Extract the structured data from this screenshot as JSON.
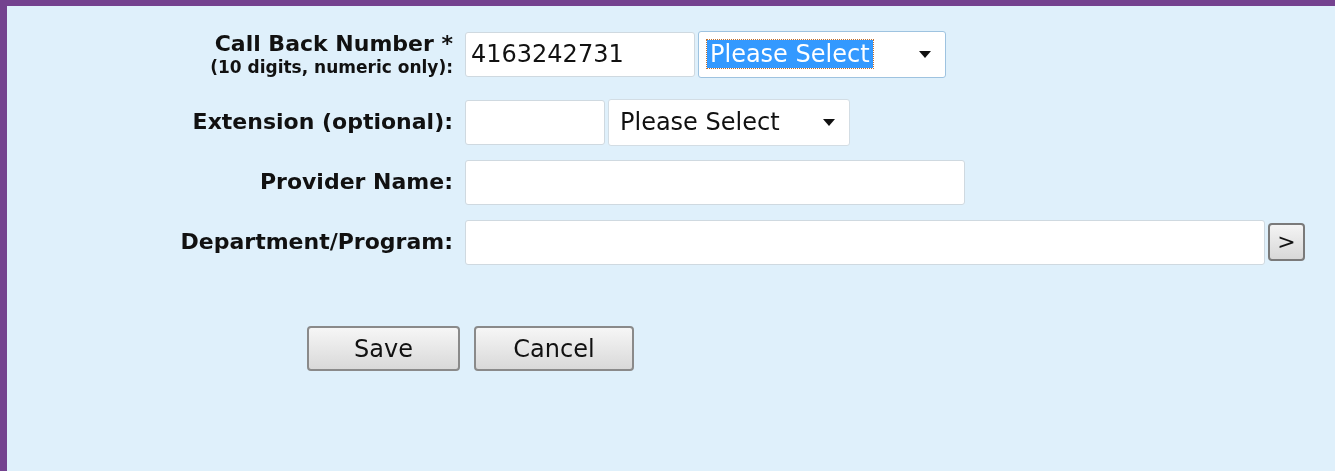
{
  "form": {
    "rows": [
      {
        "kind": "phone",
        "label": "Call Back Number *",
        "sublabel": "(10 digits, numeric only):",
        "value": "4163242731",
        "select": {
          "value": "Please Select",
          "focused": true
        }
      },
      {
        "kind": "phone",
        "label": "Extension (optional):",
        "value": "",
        "select": {
          "value": "Please Select",
          "focused": false
        }
      },
      {
        "kind": "text",
        "label": "Provider Name:",
        "value": ""
      },
      {
        "kind": "lookup",
        "label": "Department/Program:",
        "value": "",
        "button": ">"
      }
    ]
  },
  "buttons": [
    "Save",
    "Cancel"
  ]
}
